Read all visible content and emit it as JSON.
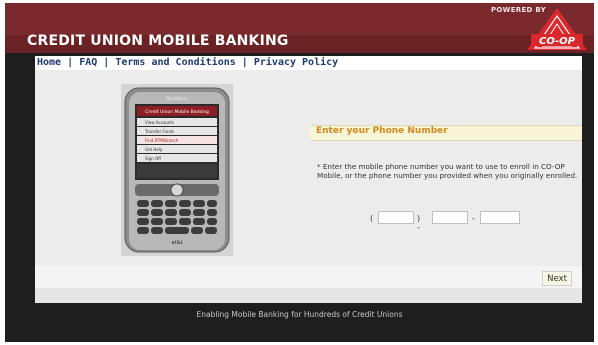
{
  "header": {
    "title": "CREDIT UNION MOBILE BANKING",
    "powered_by": "POWERED BY",
    "logo_text": "CO-OP"
  },
  "nav": {
    "home": "Home",
    "faq": "FAQ",
    "terms": "Terms and Conditions",
    "privacy": "Privacy Policy",
    "separator": "|"
  },
  "device": {
    "brand": "BlackBerry",
    "screen_title": "Credit Union Mobile Banking",
    "menu": [
      "View Accounts",
      "Transfer Funds",
      "Find ATM/Branch",
      "Get Help",
      "Sign Off"
    ],
    "carrier": "at&t"
  },
  "form": {
    "title": "Enter your Phone Number",
    "instructions": "* Enter the mobile phone number you want to use to enroll in CO-OP Mobile, or the phone number you provided when you originally enrolled.",
    "area_open": "(",
    "area_close": ") -",
    "dash": "-",
    "area_code": "",
    "prefix": "",
    "line_number": ""
  },
  "actions": {
    "next_label": "Next"
  },
  "footer": {
    "tagline": "Enabling Mobile Banking for Hundreds of Credit Unions"
  },
  "colors": {
    "header": "#7a2a2c",
    "nav_link": "#1e3b70",
    "form_title": "#d28a20",
    "logo": "#d8282e"
  }
}
